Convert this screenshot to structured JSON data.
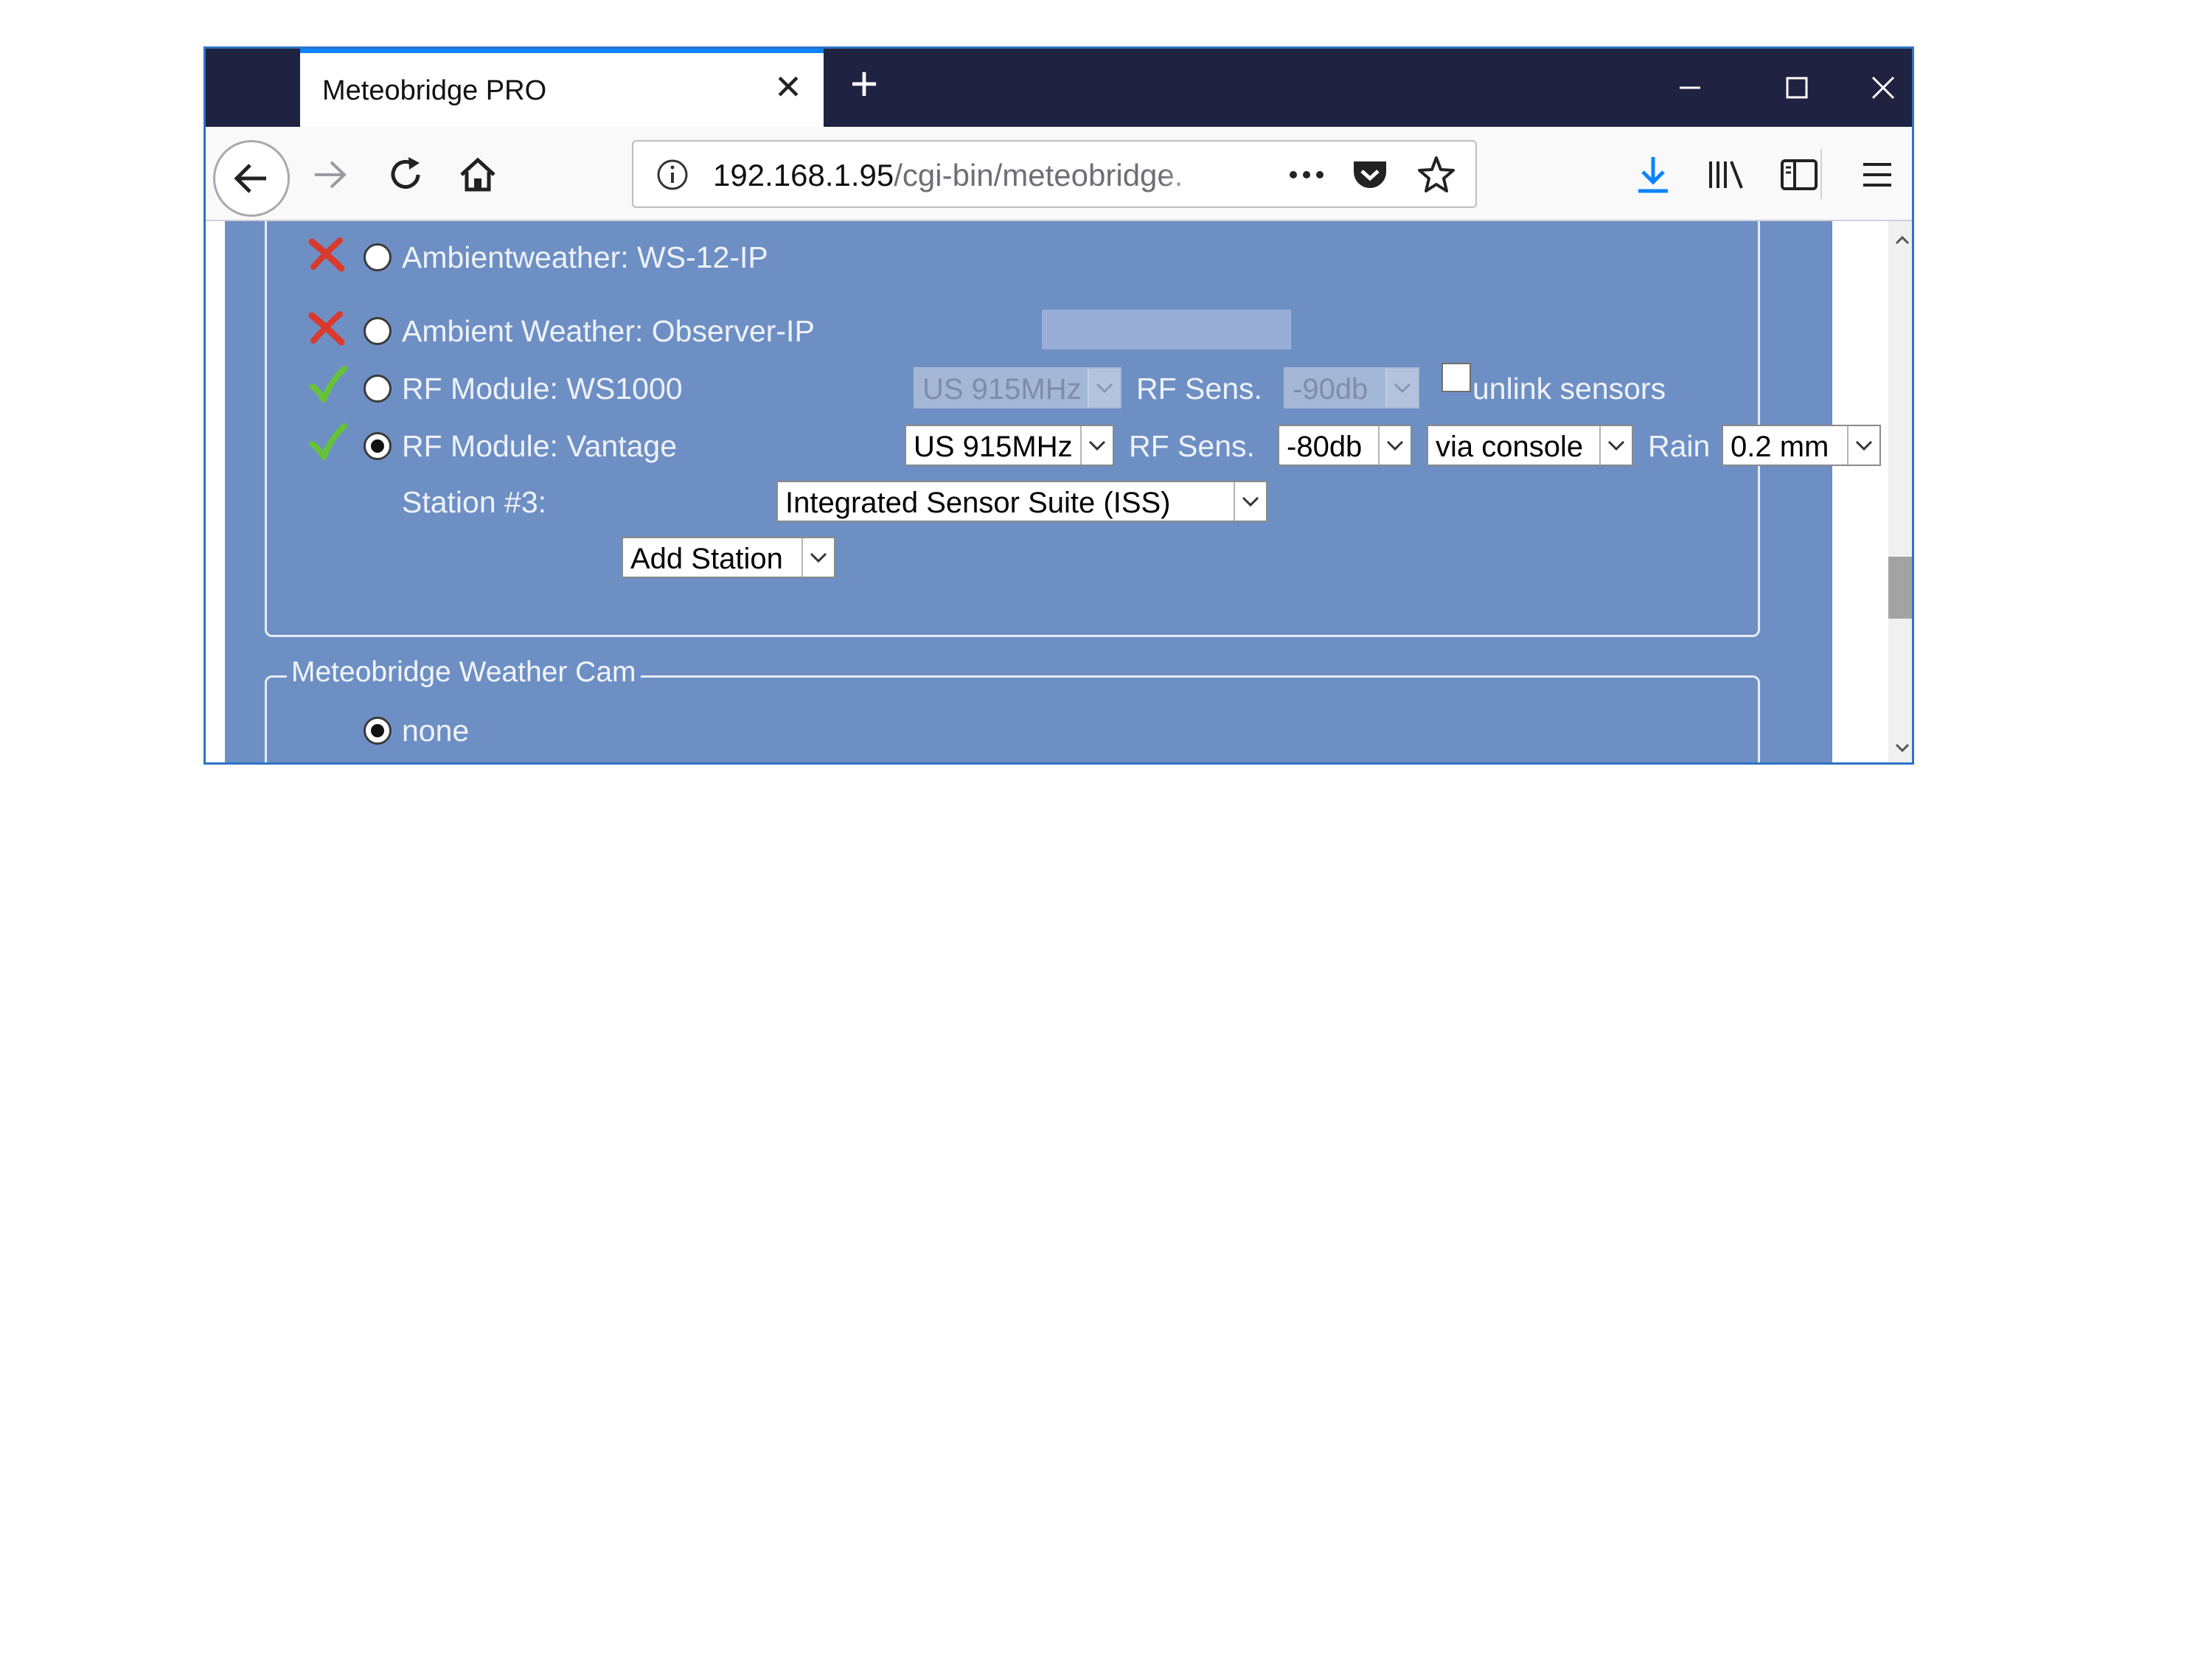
{
  "browser": {
    "tab_title": "Meteobridge PRO",
    "url_host": "192.168.1.95",
    "url_path": "/cgi-bin/meteobridge."
  },
  "stations": {
    "ws12ip": {
      "label": "Ambientweather: WS-12-IP",
      "status": "unsupported",
      "selected": false
    },
    "observer": {
      "label": "Ambient Weather: Observer-IP",
      "status": "unsupported",
      "selected": false,
      "ip_value": ""
    },
    "ws1000": {
      "label": "RF Module: WS1000",
      "status": "supported",
      "selected": false,
      "freq": "US 915MHz",
      "rf_label": "RF Sens.",
      "rf_value": "-90db",
      "unlink_label": "unlink sensors",
      "unlink_checked": false
    },
    "vantage": {
      "label": "RF Module: Vantage",
      "status": "supported",
      "selected": true,
      "freq": "US 915MHz",
      "rf_label": "RF Sens.",
      "rf_value": "-80db",
      "mode": "via console",
      "rain_label": "Rain",
      "rain_value": "0.2 mm",
      "station3_label": "Station #3:",
      "station3_value": "Integrated Sensor Suite (ISS)",
      "add_station": "Add Station"
    }
  },
  "weather_cam": {
    "legend": "Meteobridge Weather Cam",
    "none_label": "none",
    "none_selected": true
  },
  "colors": {
    "page_bg": "#6e8fc4",
    "titlebar": "#1f2240",
    "accent": "#0a84ff",
    "status_ok": "#67c23a",
    "status_bad": "#d93a2b"
  }
}
